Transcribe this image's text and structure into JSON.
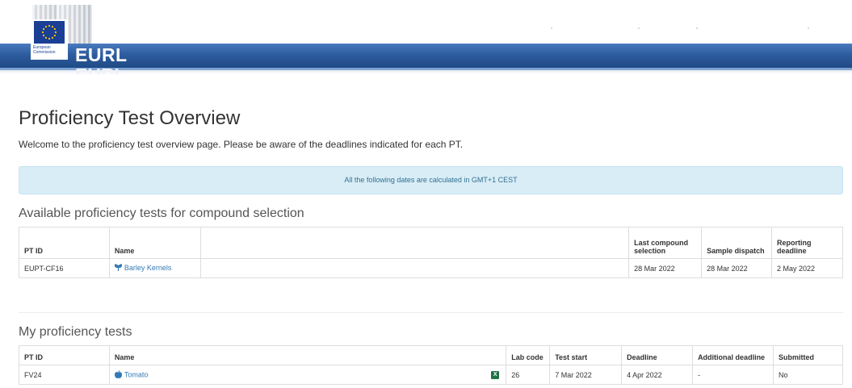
{
  "header": {
    "brand": "EURL",
    "commission_line1": "European",
    "commission_line2": "Commission"
  },
  "page": {
    "title": "Proficiency Test Overview",
    "welcome": "Welcome to the proficiency test overview page. Please be aware of the deadlines indicated for each PT.",
    "timezone_notice": "All the following dates are calculated in GMT+1 CEST"
  },
  "available": {
    "heading": "Available proficiency tests for compound selection",
    "headers": {
      "pt_id": "PT ID",
      "name": "Name",
      "last_compound": "Last compound selection",
      "sample_dispatch": "Sample dispatch",
      "reporting": "Reporting deadline"
    },
    "rows": [
      {
        "pt_id": "EUPT-CF16",
        "name": "Barley Kernels",
        "icon": "plant-sprout-icon",
        "last_compound": "28 Mar 2022",
        "sample_dispatch": "28 Mar 2022",
        "reporting": "2 May 2022"
      }
    ]
  },
  "mine": {
    "heading": "My proficiency tests",
    "headers": {
      "pt_id": "PT ID",
      "name": "Name",
      "lab_code": "Lab code",
      "test_start": "Test start",
      "deadline": "Deadline",
      "additional": "Additional deadline",
      "submitted": "Submitted"
    },
    "rows": [
      {
        "pt_id": "FV24",
        "name": "Tomato",
        "icon": "apple-icon",
        "excel_icon": "excel-icon",
        "excel_letter": "X",
        "lab_code": "26",
        "test_start": "7 Mar 2022",
        "deadline": "4 Apr 2022",
        "additional": "-",
        "submitted": "No"
      }
    ]
  },
  "colors": {
    "band": "#2e5c9e",
    "link": "#337ab7",
    "info_bg": "#d9edf7",
    "info_text": "#31708f",
    "excel": "#217346"
  }
}
